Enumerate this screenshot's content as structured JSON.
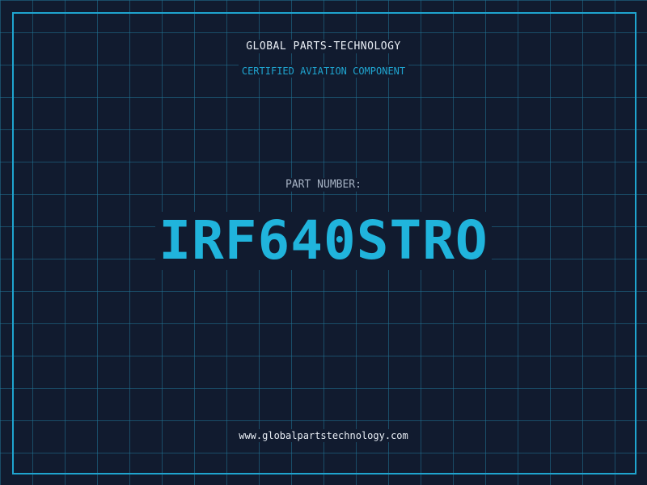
{
  "header": {
    "company": "GLOBAL PARTS-TECHNOLOGY",
    "tagline": "CERTIFIED AVIATION COMPONENT"
  },
  "part": {
    "label": "PART NUMBER:",
    "number": "IRF640STRO"
  },
  "footer": {
    "website": "www.globalpartstechnology.com"
  },
  "colors": {
    "background": "#111b2f",
    "grid": "#207496",
    "accent": "#1fa4cf",
    "part_number": "#20b4dc",
    "text_light": "#e9eef5",
    "text_muted": "#a7b3c4"
  }
}
